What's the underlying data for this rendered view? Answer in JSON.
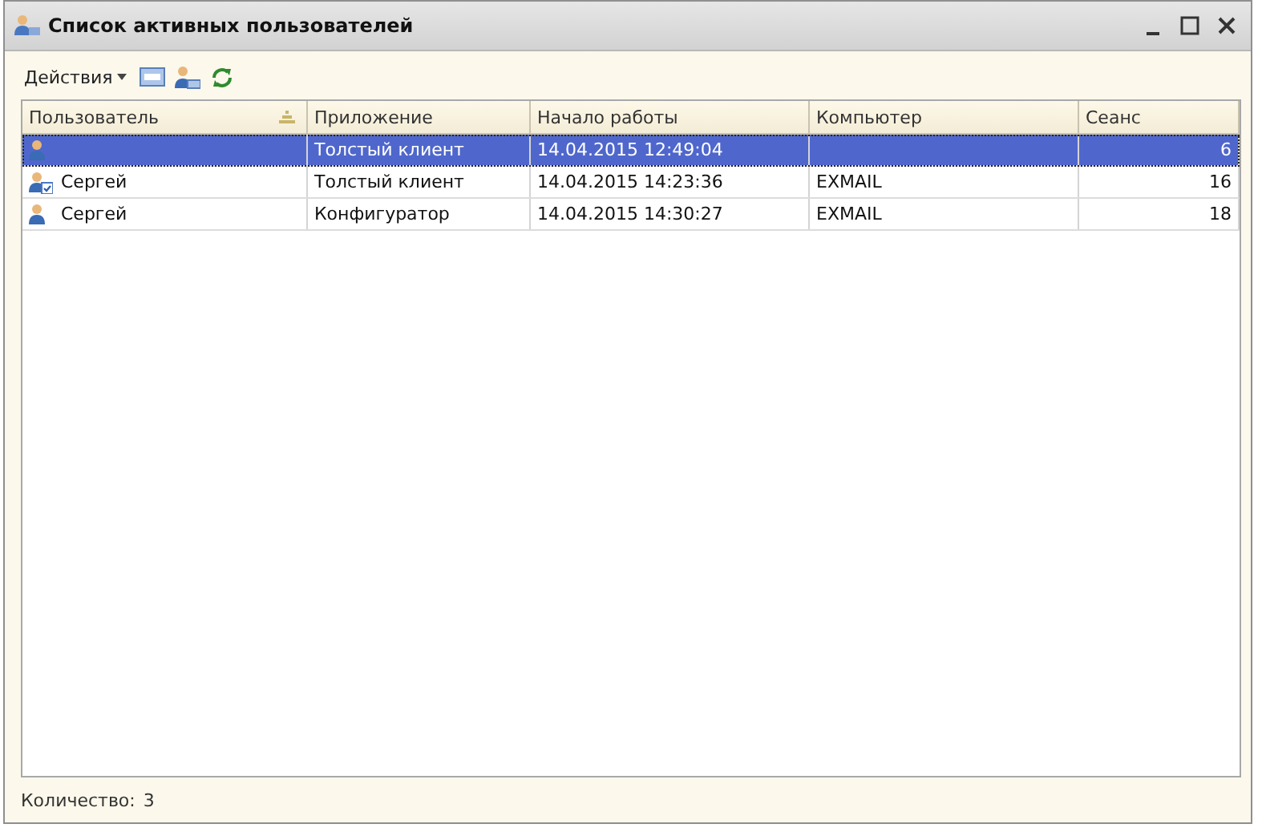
{
  "window": {
    "title": "Список активных пользователей"
  },
  "toolbar": {
    "actions_label": "Действия"
  },
  "table": {
    "columns": [
      {
        "label": "Пользователь",
        "sorted": true
      },
      {
        "label": "Приложение",
        "sorted": false
      },
      {
        "label": "Начало работы",
        "sorted": false
      },
      {
        "label": "Компьютер",
        "sorted": false
      },
      {
        "label": "Сеанс",
        "sorted": false
      }
    ],
    "rows": [
      {
        "selected": true,
        "kind": "user",
        "cells": [
          "",
          "Толстый клиент",
          "14.04.2015 12:49:04",
          "",
          "6"
        ]
      },
      {
        "selected": false,
        "kind": "user-check",
        "cells": [
          "Сергей",
          "Толстый клиент",
          "14.04.2015 14:23:36",
          "EXMAIL",
          "16"
        ]
      },
      {
        "selected": false,
        "kind": "user",
        "cells": [
          "Сергей",
          "Конфигуратор",
          "14.04.2015 14:30:27",
          "EXMAIL",
          "18"
        ]
      }
    ]
  },
  "footer": {
    "count_label": "Количество:",
    "count": "3"
  }
}
